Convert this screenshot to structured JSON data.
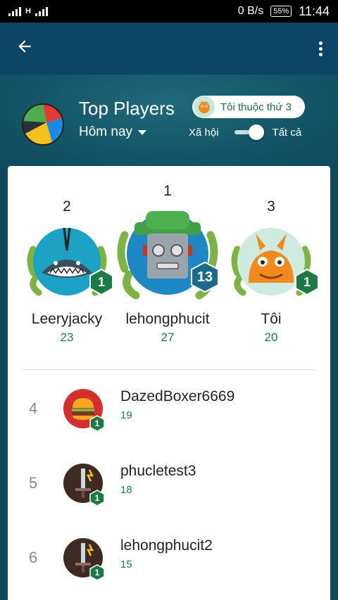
{
  "status_bar": {
    "net_type": "H",
    "data_rate": "0 B/s",
    "battery": "55%",
    "time": "11:44"
  },
  "app_bar": {
    "back_icon": "arrow-left-icon",
    "menu_icon": "more-vert-icon"
  },
  "header": {
    "title": "Top Players",
    "period": "Hôm nay",
    "rank_chip": "Tôi thuộc thứ 3",
    "toggle_left": "Xã hội",
    "toggle_right": "Tất cả"
  },
  "podium": [
    {
      "rank": "2",
      "name": "Leeryjacky",
      "score": "23",
      "level": "1"
    },
    {
      "rank": "1",
      "name": "lehongphucit",
      "score": "27",
      "level": "13"
    },
    {
      "rank": "3",
      "name": "Tôi",
      "score": "20",
      "level": "1"
    }
  ],
  "list": [
    {
      "rank": "4",
      "name": "DazedBoxer6669",
      "score": "19",
      "level": "1"
    },
    {
      "rank": "5",
      "name": "phucletest3",
      "score": "18",
      "level": "1"
    },
    {
      "rank": "6",
      "name": "lehongphucit2",
      "score": "15",
      "level": "1"
    }
  ],
  "colors": {
    "app_bar": "#0d4566",
    "background": "#0f4a5c",
    "accent_green": "#1d7a4a",
    "badge_green": "#1e7a45"
  }
}
